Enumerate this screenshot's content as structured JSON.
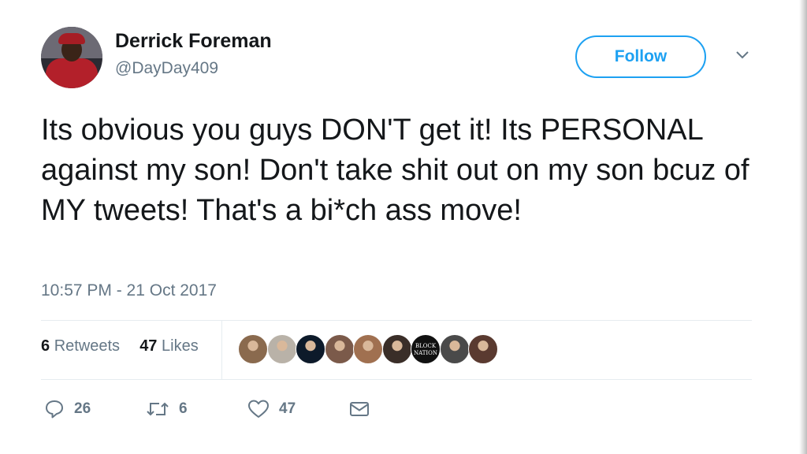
{
  "user": {
    "name": "Derrick Foreman",
    "handle": "@DayDay409",
    "avatar_icon": "profile-photo"
  },
  "follow_label": "Follow",
  "tweet": {
    "text": "Its obvious you guys DON'T get it! Its PERSONAL against my son! Don't take shit out on my son bcuz of MY tweets! That's a bi*ch ass move!",
    "timestamp": "10:57 PM - 21 Oct 2017"
  },
  "stats": {
    "retweets_count": "6",
    "retweets_label": "Retweets",
    "likes_count": "47",
    "likes_label": "Likes"
  },
  "likers": [
    {
      "color": "#8a6a4e"
    },
    {
      "color": "#b9b2a8"
    },
    {
      "color": "#0d1a2a"
    },
    {
      "color": "#7b5a4a"
    },
    {
      "color": "#a07050"
    },
    {
      "color": "#3a2e28"
    },
    {
      "color": "#111111",
      "text": "BLOCK NATION"
    },
    {
      "color": "#4a4a4a"
    },
    {
      "color": "#5a3a30"
    }
  ],
  "actions": {
    "reply_count": "26",
    "retweet_count": "6",
    "like_count": "47"
  },
  "colors": {
    "accent": "#1da1f2",
    "text": "#14171a",
    "muted": "#657786",
    "divider": "#e6ecf0"
  }
}
